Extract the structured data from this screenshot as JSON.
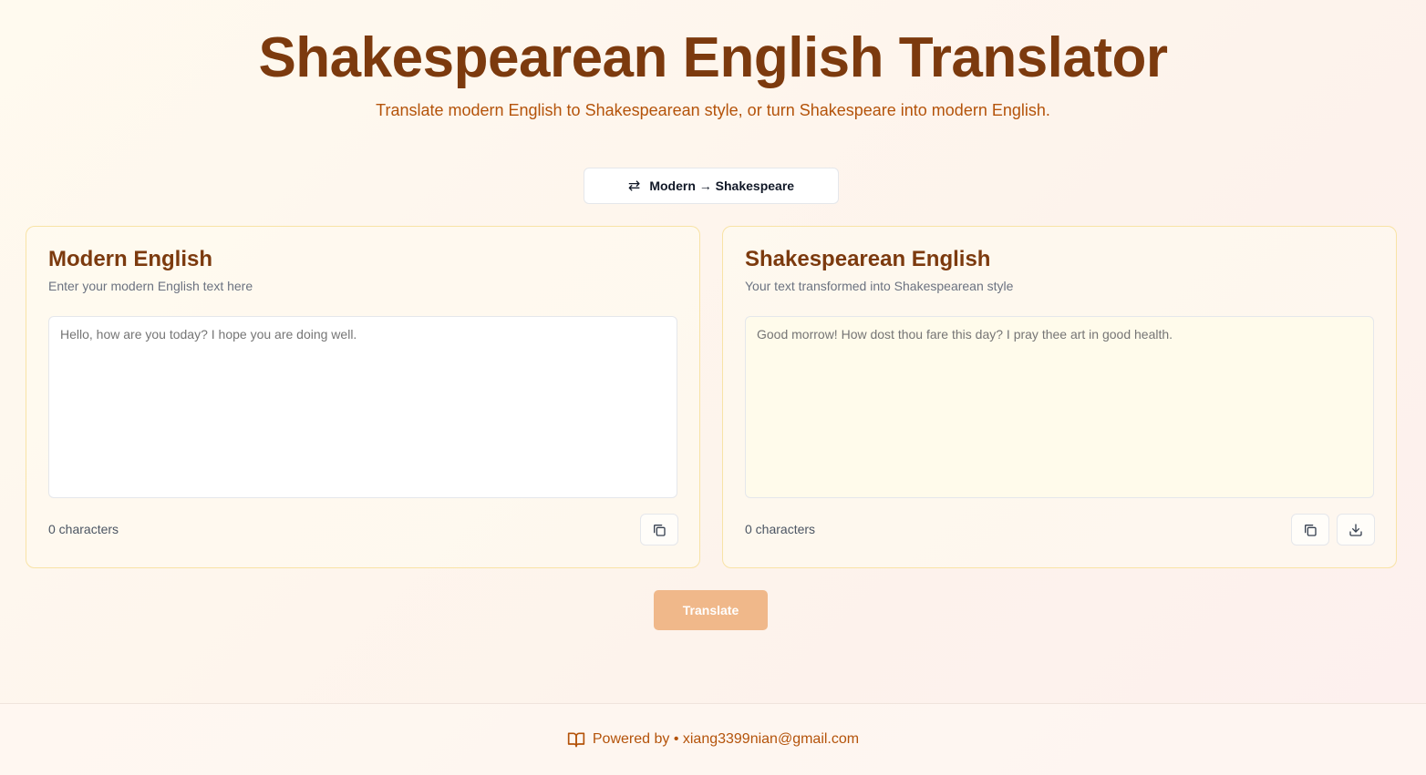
{
  "header": {
    "title": "Shakespearean English Translator",
    "subtitle": "Translate modern English to Shakespearean style, or turn Shakespeare into modern English."
  },
  "mode_toggle": {
    "icon": "swap-icon",
    "label": "Modern → Shakespeare"
  },
  "input_panel": {
    "title": "Modern English",
    "description": "Enter your modern English text here",
    "placeholder": "Hello, how are you today? I hope you are doing well.",
    "value": "",
    "char_count": "0 characters",
    "copy_icon": "copy-icon"
  },
  "output_panel": {
    "title": "Shakespearean English",
    "description": "Your text transformed into Shakespearean style",
    "placeholder": "Good morrow! How dost thou fare this day? I pray thee art in good health.",
    "value": "",
    "char_count": "0 characters",
    "copy_icon": "copy-icon",
    "download_icon": "download-icon"
  },
  "translate_button": {
    "label": "Translate"
  },
  "footer": {
    "icon": "book-open-icon",
    "text": "Powered by • xiang3399nian@gmail.com"
  },
  "colors": {
    "title": "#7c3a0e",
    "accent": "#b4530a",
    "button_disabled": "#f0b88a",
    "card_border": "#f8e3a6"
  }
}
